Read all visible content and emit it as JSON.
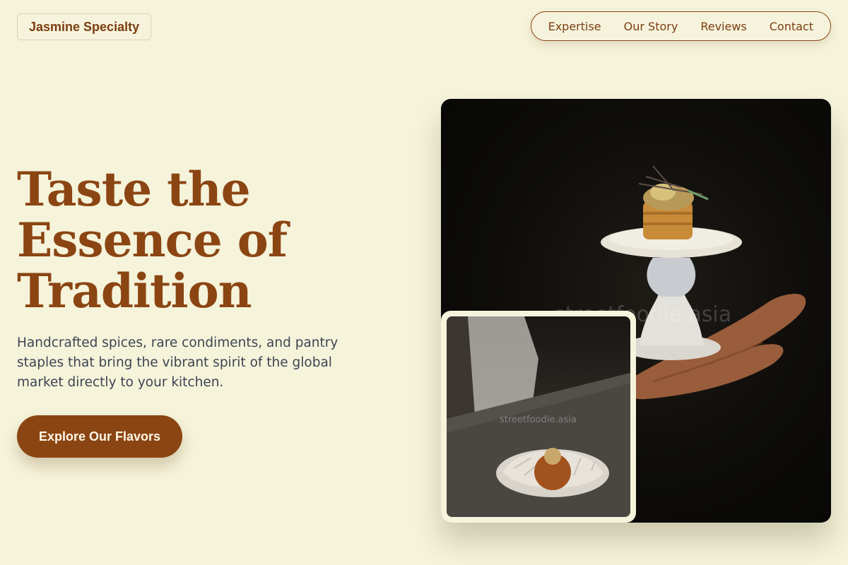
{
  "header": {
    "brand": "Jasmine Specialty",
    "nav": [
      "Expertise",
      "Our Story",
      "Reviews",
      "Contact"
    ]
  },
  "hero": {
    "headline": [
      "Taste the",
      "Essence of",
      "Tradition"
    ],
    "subtext": "Handcrafted spices, rare condiments, and pantry staples that bring the vibrant spirit of the global market directly to your kitchen.",
    "cta_label": "Explore Our Flavors"
  },
  "images": {
    "main_watermark": "streetfoodie.asia",
    "inset_watermark": "streetfoodie.asia"
  },
  "colors": {
    "background": "#f5f3da",
    "accent": "#8b4513",
    "body_text": "#3d4552"
  }
}
